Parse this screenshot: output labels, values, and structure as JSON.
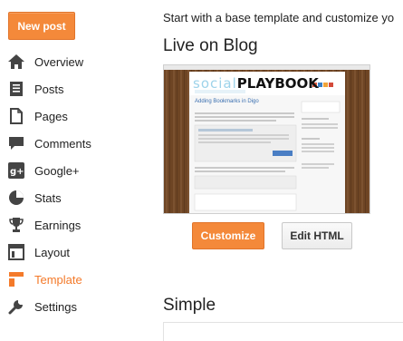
{
  "actions": {
    "new_post": "New post"
  },
  "colors": {
    "accent": "#f4893a",
    "active_text": "#f47a2a"
  },
  "sidebar": {
    "items": [
      {
        "label": "Overview",
        "icon": "home-icon"
      },
      {
        "label": "Posts",
        "icon": "posts-icon"
      },
      {
        "label": "Pages",
        "icon": "pages-icon"
      },
      {
        "label": "Comments",
        "icon": "comments-icon"
      },
      {
        "label": "Google+",
        "icon": "google-plus-icon"
      },
      {
        "label": "Stats",
        "icon": "stats-pie-icon"
      },
      {
        "label": "Earnings",
        "icon": "trophy-icon"
      },
      {
        "label": "Layout",
        "icon": "layout-icon"
      },
      {
        "label": "Template",
        "icon": "template-icon",
        "active": true
      },
      {
        "label": "Settings",
        "icon": "wrench-icon"
      }
    ]
  },
  "main": {
    "intro": "Start with a base template and customize yo",
    "live": {
      "title": "Live on Blog",
      "preview": {
        "header_left": "social",
        "header_right": "PLAYBOOK",
        "post_title": "Adding Bookmarks in Digo"
      },
      "customize_label": "Customize",
      "edit_html_label": "Edit HTML"
    },
    "simple": {
      "title": "Simple"
    }
  }
}
